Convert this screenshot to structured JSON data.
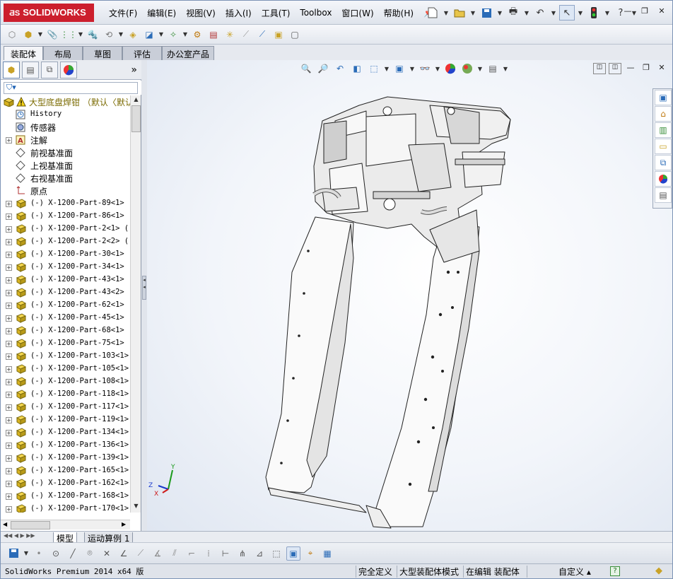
{
  "app": {
    "logo_ds": "ƋS",
    "logo_text": "SOLIDWORKS"
  },
  "menu": [
    "文件(F)",
    "编辑(E)",
    "视图(V)",
    "插入(I)",
    "工具(T)",
    "Toolbox",
    "窗口(W)",
    "帮助(H)"
  ],
  "command_tabs": [
    "装配体",
    "布局",
    "草图",
    "评估",
    "办公室产品"
  ],
  "tree": {
    "root": "大型底盘焊钳  （默认〈默认",
    "items": [
      {
        "label": "History",
        "icon": "history-icon",
        "cn": false,
        "expand": false
      },
      {
        "label": "传感器",
        "icon": "sensor-icon",
        "cn": true,
        "expand": false
      },
      {
        "label": "注解",
        "icon": "annotation-icon",
        "cn": true,
        "expand": true
      },
      {
        "label": "前视基准面",
        "icon": "plane-icon",
        "cn": true,
        "expand": false
      },
      {
        "label": "上视基准面",
        "icon": "plane-icon",
        "cn": true,
        "expand": false
      },
      {
        "label": "右视基准面",
        "icon": "plane-icon",
        "cn": true,
        "expand": false
      },
      {
        "label": "原点",
        "icon": "origin-icon",
        "cn": true,
        "expand": false
      },
      {
        "label": "(-) X-1200-Part-89<1> (",
        "icon": "part-icon",
        "cn": false,
        "expand": true
      },
      {
        "label": "(-) X-1200-Part-86<1> (",
        "icon": "part-icon",
        "cn": false,
        "expand": true
      },
      {
        "label": "(-) X-1200-Part-2<1> (",
        "icon": "part-icon",
        "cn": false,
        "expand": true
      },
      {
        "label": "(-) X-1200-Part-2<2> (",
        "icon": "part-icon",
        "cn": false,
        "expand": true
      },
      {
        "label": "(-) X-1200-Part-30<1> (",
        "icon": "part-icon",
        "cn": false,
        "expand": true
      },
      {
        "label": "(-) X-1200-Part-34<1> (",
        "icon": "part-icon",
        "cn": false,
        "expand": true
      },
      {
        "label": "(-) X-1200-Part-43<1> (",
        "icon": "part-icon",
        "cn": false,
        "expand": true
      },
      {
        "label": "(-) X-1200-Part-43<2> (",
        "icon": "part-icon",
        "cn": false,
        "expand": true
      },
      {
        "label": "(-) X-1200-Part-62<1> (",
        "icon": "part-icon",
        "cn": false,
        "expand": true
      },
      {
        "label": "(-) X-1200-Part-45<1> (",
        "icon": "part-icon",
        "cn": false,
        "expand": true
      },
      {
        "label": "(-) X-1200-Part-68<1> (",
        "icon": "part-icon",
        "cn": false,
        "expand": true
      },
      {
        "label": "(-) X-1200-Part-75<1> (",
        "icon": "part-icon",
        "cn": false,
        "expand": true
      },
      {
        "label": "(-) X-1200-Part-103<1>",
        "icon": "part-icon",
        "cn": false,
        "expand": true
      },
      {
        "label": "(-) X-1200-Part-105<1>",
        "icon": "part-icon",
        "cn": false,
        "expand": true
      },
      {
        "label": "(-) X-1200-Part-108<1>",
        "icon": "part-icon",
        "cn": false,
        "expand": true
      },
      {
        "label": "(-) X-1200-Part-118<1>",
        "icon": "part-icon",
        "cn": false,
        "expand": true
      },
      {
        "label": "(-) X-1200-Part-117<1>",
        "icon": "part-icon",
        "cn": false,
        "expand": true
      },
      {
        "label": "(-) X-1200-Part-119<1>",
        "icon": "part-icon",
        "cn": false,
        "expand": true
      },
      {
        "label": "(-) X-1200-Part-134<1>",
        "icon": "part-icon",
        "cn": false,
        "expand": true
      },
      {
        "label": "(-) X-1200-Part-136<1>",
        "icon": "part-icon",
        "cn": false,
        "expand": true
      },
      {
        "label": "(-) X-1200-Part-139<1>",
        "icon": "part-icon",
        "cn": false,
        "expand": true
      },
      {
        "label": "(-) X-1200-Part-165<1>",
        "icon": "part-icon",
        "cn": false,
        "expand": true
      },
      {
        "label": "(-) X-1200-Part-162<1>",
        "icon": "part-icon",
        "cn": false,
        "expand": true
      },
      {
        "label": "(-) X-1200-Part-168<1>",
        "icon": "part-icon",
        "cn": false,
        "expand": true
      },
      {
        "label": "(-) X-1200-Part-170<1>",
        "icon": "part-icon",
        "cn": false,
        "expand": true
      }
    ]
  },
  "triad": {
    "x": "X",
    "y": "Y",
    "z": "Z"
  },
  "bottom_tabs": [
    "模型",
    "运动算例 1"
  ],
  "status": {
    "product": "SolidWorks Premium 2014 x64 版",
    "defined": "完全定义",
    "mode": "大型装配体模式",
    "editing": "在编辑 装配体",
    "units": "自定义",
    "help": "?"
  },
  "colors": {
    "brand": "#cc1f2d",
    "accent": "#1a5fb4"
  }
}
